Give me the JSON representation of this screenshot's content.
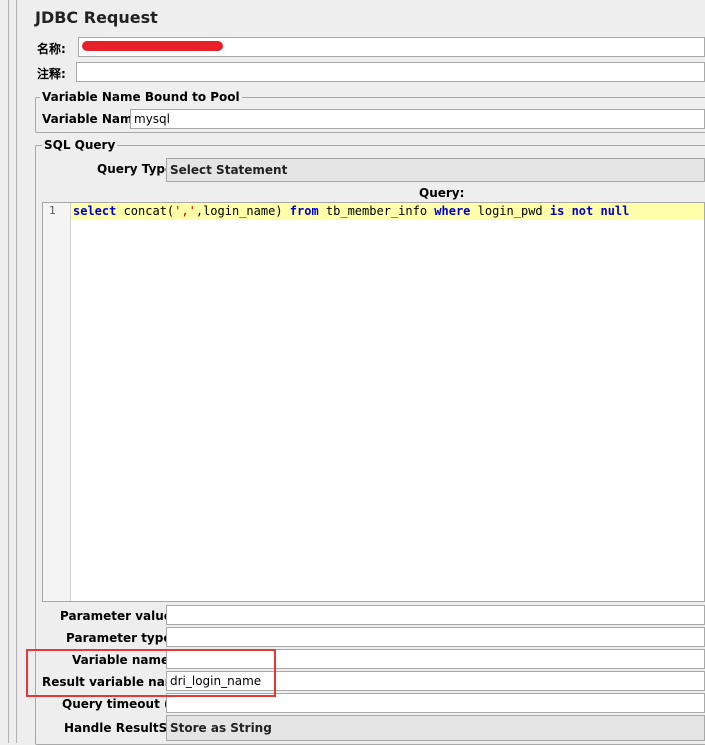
{
  "header": {
    "title": "JDBC Request"
  },
  "name_row": {
    "label": "名称:",
    "value": ""
  },
  "comment_row": {
    "label": "注释:",
    "value": ""
  },
  "pool_section": {
    "legend": "Variable Name Bound to Pool",
    "variable_name_label": "Variable Name:",
    "variable_name_value": "mysql"
  },
  "sql_section": {
    "legend": "SQL Query",
    "query_type_label": "Query Type:",
    "query_type_value": "Select Statement",
    "query_header": "Query:",
    "line_number": "1",
    "code": {
      "t1": "select",
      "t2": " concat(",
      "t3": "','",
      "t4": ",login_name) ",
      "t5": "from",
      "t6": " tb_member_info ",
      "t7": "where",
      "t8": " login_pwd ",
      "t9": "is",
      "t10": " ",
      "t11": "not",
      "t12": " ",
      "t13": "null"
    }
  },
  "params": {
    "parameter_values_label": "Parameter values:",
    "parameter_values_value": "",
    "parameter_types_label": "Parameter types:",
    "parameter_types_value": "",
    "variable_names_label": "Variable names:",
    "variable_names_value": "",
    "result_variable_label": "Result variable name:",
    "result_variable_value": "dri_login_name",
    "query_timeout_label": "Query timeout (s):",
    "query_timeout_value": "",
    "handle_resultset_label": "Handle ResultSet:",
    "handle_resultset_value": "Store as String"
  },
  "colors": {
    "highlight": "#e53935",
    "redaction": "#e8202a",
    "editor_line": "#ffffaa"
  }
}
